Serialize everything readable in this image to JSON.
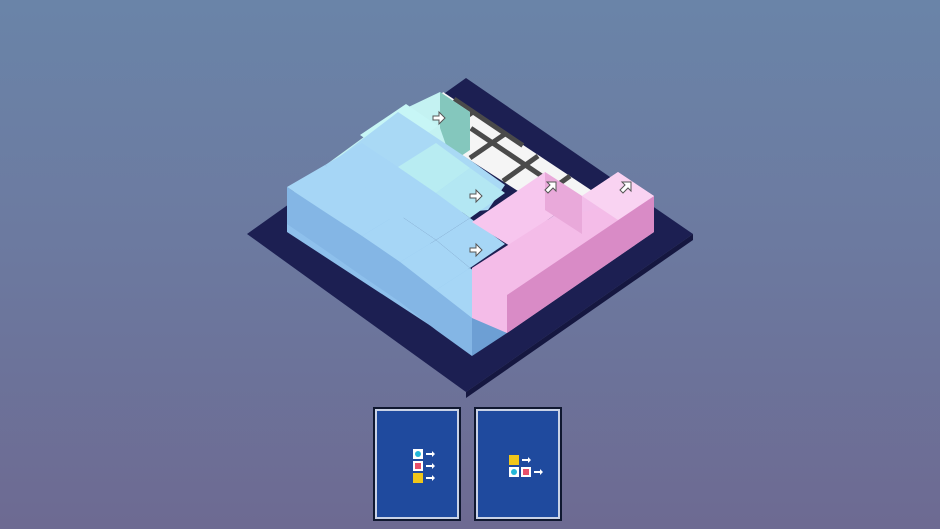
{
  "colors": {
    "background_top": "#6a84a8",
    "background_bottom": "#6d6a92",
    "board_base": "#1c1f52",
    "grid_line": "#4a4a4a",
    "grid_cell": "#f6f6f6",
    "blue_top": "#a6d7f6",
    "blue_light_top": "#c7f4f4",
    "pink_top": "#f7c6ee",
    "card_bg": "#1f4a9e"
  },
  "board": {
    "rows": 5,
    "cols": 5,
    "pieces": [
      {
        "color": "cyan",
        "cells": [
          [
            0,
            0
          ],
          [
            0,
            1
          ],
          [
            0,
            2
          ]
        ],
        "arrow": "down-right"
      },
      {
        "color": "blue",
        "cells": [
          [
            1,
            0
          ],
          [
            1,
            1
          ],
          [
            1,
            2
          ],
          [
            1,
            3
          ]
        ],
        "arrow": "down-right"
      },
      {
        "color": "blue",
        "cells": [
          [
            2,
            0
          ],
          [
            2,
            1
          ],
          [
            2,
            2
          ],
          [
            2,
            3
          ]
        ],
        "arrow": "down-right"
      },
      {
        "color": "blue",
        "cells": [
          [
            3,
            0
          ],
          [
            3,
            1
          ],
          [
            3,
            2
          ],
          [
            3,
            3
          ],
          [
            3,
            4
          ]
        ],
        "arrow": "down-right"
      },
      {
        "color": "blue",
        "cells": [
          [
            4,
            0
          ],
          [
            4,
            1
          ],
          [
            4,
            2
          ],
          [
            4,
            3
          ],
          [
            4,
            4
          ]
        ],
        "arrow": "down-right"
      },
      {
        "color": "pink",
        "cells": [
          [
            3,
            4
          ],
          [
            2,
            4
          ],
          [
            1,
            4
          ]
        ],
        "arrow": "up-right"
      },
      {
        "color": "pink",
        "cells": [
          [
            4,
            4
          ],
          [
            4,
            3
          ],
          [
            4,
            2
          ],
          [
            4,
            1
          ]
        ],
        "arrow": "up-right"
      }
    ]
  },
  "cards": [
    {
      "name": "card-vertical-stack",
      "blocks": [
        "cyan",
        "red",
        "yellow"
      ],
      "icon": "three-blocks-arrow-right-icon"
    },
    {
      "name": "card-l-shape",
      "blocks": [
        "yellow",
        "cyan",
        "red"
      ],
      "icon": "l-blocks-arrow-right-icon"
    }
  ]
}
